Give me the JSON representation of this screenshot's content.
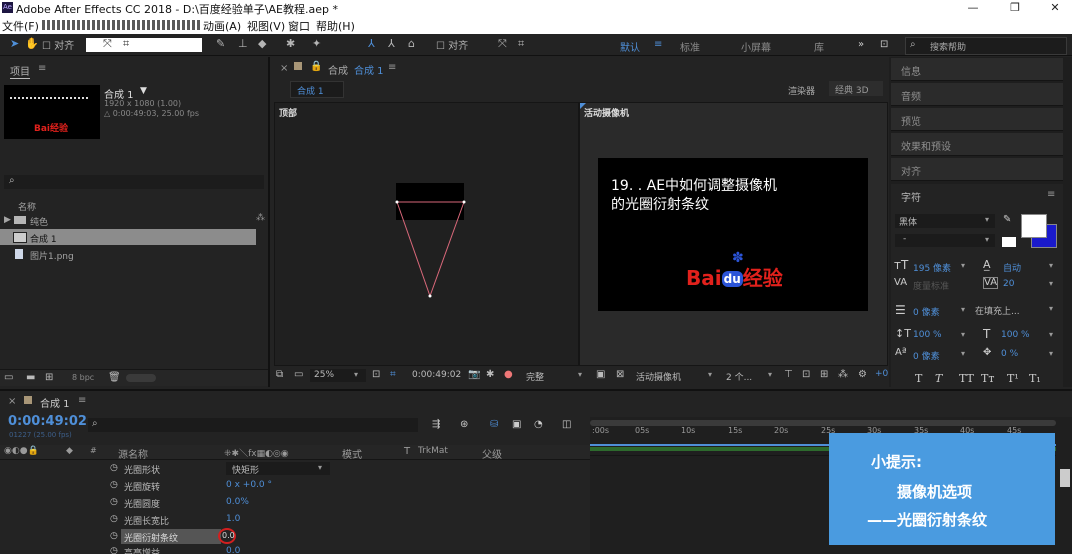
{
  "window": {
    "title": "Adobe After Effects CC 2018 - D:\\百度经验单子\\AE教程.aep *",
    "app_icon": "Ae"
  },
  "menu": {
    "file": "文件(F)",
    "animation": "动画(A)",
    "view": "视图(V)",
    "window": "窗口",
    "help": "帮助(H)"
  },
  "toolbar": {
    "snap1": "对齐",
    "snap2": "对齐",
    "ws_default": "默认",
    "ws_standard": "标准",
    "ws_small": "小屏幕",
    "ws_library": "库",
    "search_placeholder": "搜索帮助"
  },
  "project": {
    "tab": "项目",
    "comp_name": "合成 1",
    "comp_dims": "1920 x 1080 (1.00)",
    "comp_dur": "△ 0:00:49:03, 25.00 fps",
    "col_name": "名称",
    "items": [
      {
        "name": "纯色",
        "type": "folder"
      },
      {
        "name": "合成 1",
        "type": "comp"
      },
      {
        "name": "图片1.png",
        "type": "image"
      }
    ],
    "bpc": "8 bpc"
  },
  "comp": {
    "tab_prefix": "合成",
    "tab_name": "合成 1",
    "subtab": "合成 1",
    "renderer_label": "渲染器",
    "renderer": "经典 3D",
    "view_left": "顶部",
    "view_right": "活动摄像机",
    "thumb_text": "Bai经验",
    "overlay_line1": "19. . AE中如何调整摄像机",
    "overlay_line2": "的光圈衍射条纹",
    "logo_text": "Bai",
    "logo_du": "du",
    "logo_cn": "经验",
    "zoom": "25%",
    "timecode": "0:00:49:02",
    "quality": "完整",
    "camera": "活动摄像机",
    "views": "2 个..."
  },
  "right_panels": [
    "信息",
    "音频",
    "预览",
    "效果和预设",
    "对齐"
  ],
  "character": {
    "title": "字符",
    "font": "黑体",
    "style": "-",
    "size": "195 像素",
    "leading": "自动",
    "kerning": "度量标准",
    "tracking": "20",
    "stroke_width": "0 像素",
    "stroke_mode": "在填充上...",
    "vscale": "100 %",
    "hscale": "100 %",
    "baseline": "0 像素",
    "tsume": "0 %",
    "styles": [
      "T",
      "T",
      "TT",
      "Tт",
      "T¹",
      "T₁"
    ]
  },
  "timeline": {
    "tab": "合成 1",
    "timecode": "0:00:49:02",
    "frames": "01227 (25.00 fps)",
    "col_source": "源名称",
    "col_mode": "模式",
    "col_t": "T",
    "col_trkmat": "TrkMat",
    "col_parent": "父级",
    "props": [
      {
        "name": "光圈形状",
        "value": "快矩形"
      },
      {
        "name": "光圈旋转",
        "value": "0 x +0.0 °"
      },
      {
        "name": "光圈圆度",
        "value": "0.0%"
      },
      {
        "name": "光圈长宽比",
        "value": "1.0"
      },
      {
        "name": "光圈衍射条纹",
        "value": "0.0"
      },
      {
        "name": "高亮增益",
        "value": "0.0"
      }
    ],
    "ticks": [
      ":00s",
      "05s",
      "10s",
      "15s",
      "20s",
      "25s",
      "30s",
      "35s",
      "40s",
      "45s"
    ]
  },
  "tip": {
    "title": "小提示:",
    "line1": "摄像机选项",
    "line2": "——光圈衍射条纹"
  },
  "colors": {
    "accent_blue": "#2d8ceb",
    "tip_bg": "#4a9be0",
    "baidu_red": "#e1211c",
    "baidu_blue": "#2b54d8"
  }
}
